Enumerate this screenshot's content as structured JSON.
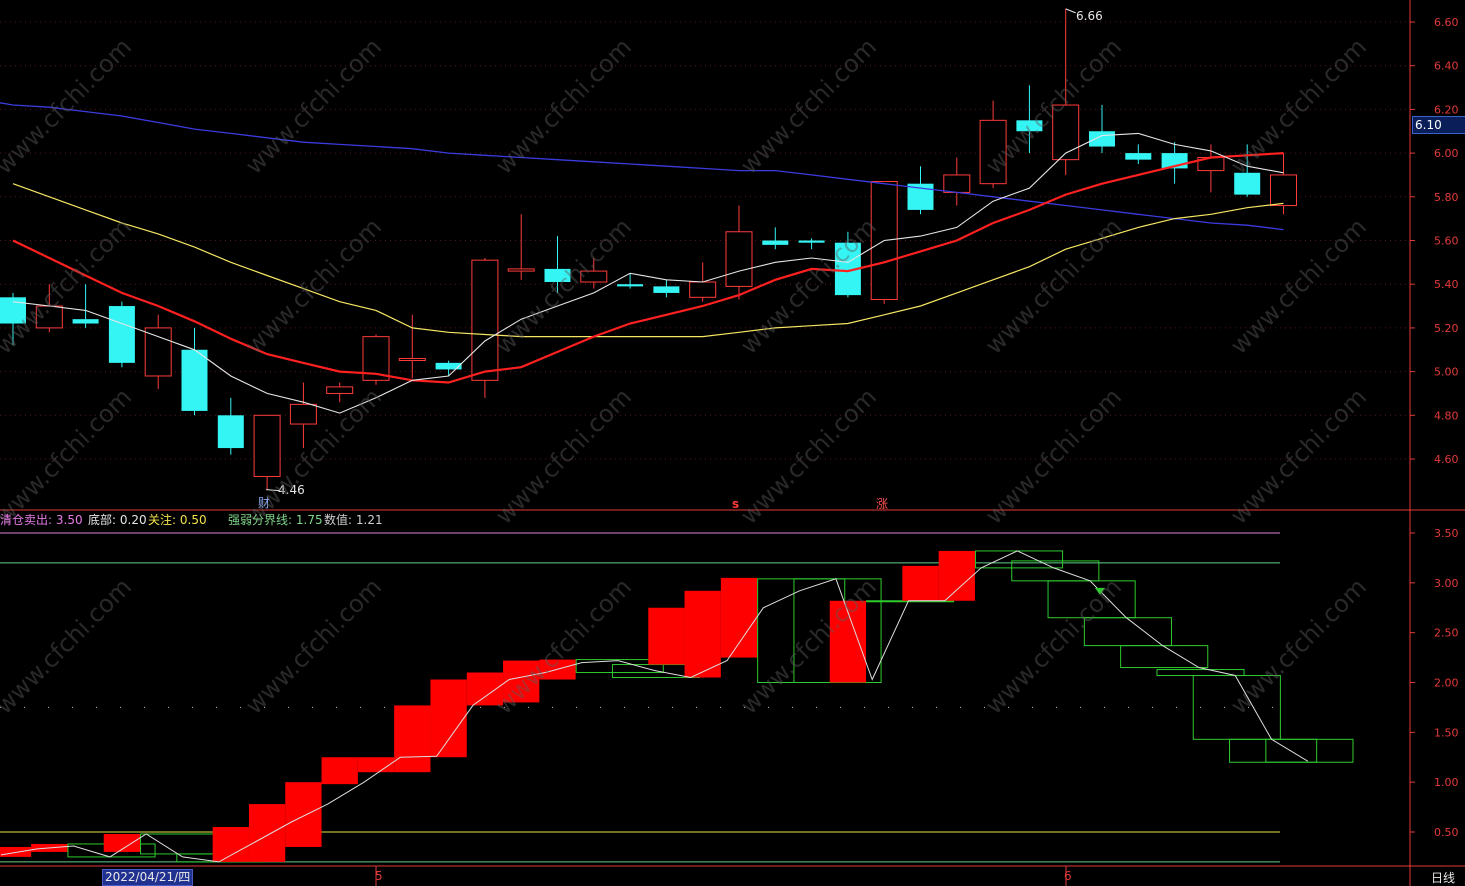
{
  "colors": {
    "background": "#000000",
    "up": "#ff3b3b",
    "down": "#34f4f4",
    "ma_white": "#e6e6e6",
    "ma_red": "#ff2020",
    "ma_yellow": "#f5e663",
    "ma_blue": "#3b3be0",
    "axis": "#e23a3a",
    "box_green": "#2ecc2e",
    "box_red": "#ff0000"
  },
  "markers": {
    "high_label": "6.66",
    "low_label": "4.46",
    "event_cai": "财",
    "event_s": "s",
    "event_zhang": "涨"
  },
  "last_price": "6.10",
  "indicator": {
    "items": [
      {
        "key": "清仓卖出",
        "sep": ": ",
        "value": "3.50",
        "color": "#e77be7"
      },
      {
        "key": "底部",
        "sep": ": ",
        "value": "0.20",
        "color": "#e6e6e6"
      },
      {
        "key": "关注",
        "sep": ": ",
        "value": "0.50",
        "color": "#f3e34a"
      },
      {
        "key": "强弱分界线",
        "sep": ": ",
        "value": "1.75",
        "color": "#7fd68a"
      },
      {
        "key": "数值",
        "sep": ": ",
        "value": "1.21",
        "color": "#cfcfcf"
      }
    ]
  },
  "bottom_axis": {
    "date_label": "2022/04/21/四",
    "month_5": "5",
    "month_6": "6",
    "tab_label": "日线"
  },
  "watermark_text": "www.cfchi.com",
  "chart_data": [
    {
      "type": "candlestick",
      "title": "",
      "ylim": [
        4.4,
        6.7
      ],
      "yticks": [
        "6.60",
        "6.40",
        "6.20",
        "6.00",
        "5.80",
        "5.60",
        "5.40",
        "5.20",
        "5.00",
        "4.80",
        "4.60"
      ],
      "grid": true,
      "candles": [
        {
          "o": 5.34,
          "h": 5.36,
          "l": 5.12,
          "c": 5.22
        },
        {
          "o": 5.2,
          "h": 5.4,
          "l": 5.18,
          "c": 5.3
        },
        {
          "o": 5.24,
          "h": 5.4,
          "l": 5.2,
          "c": 5.22
        },
        {
          "o": 5.3,
          "h": 5.32,
          "l": 5.02,
          "c": 5.04
        },
        {
          "o": 4.98,
          "h": 5.26,
          "l": 4.92,
          "c": 5.2
        },
        {
          "o": 5.1,
          "h": 5.2,
          "l": 4.8,
          "c": 4.82
        },
        {
          "o": 4.8,
          "h": 4.88,
          "l": 4.62,
          "c": 4.65
        },
        {
          "o": 4.52,
          "h": 4.8,
          "l": 4.46,
          "c": 4.8
        },
        {
          "o": 4.76,
          "h": 4.95,
          "l": 4.65,
          "c": 4.85
        },
        {
          "o": 4.9,
          "h": 4.95,
          "l": 4.86,
          "c": 4.93
        },
        {
          "o": 4.96,
          "h": 5.17,
          "l": 4.94,
          "c": 5.16
        },
        {
          "o": 5.06,
          "h": 5.26,
          "l": 4.97,
          "c": 5.06
        },
        {
          "o": 5.04,
          "h": 5.05,
          "l": 4.98,
          "c": 5.01
        },
        {
          "o": 4.96,
          "h": 5.52,
          "l": 4.88,
          "c": 5.51
        },
        {
          "o": 5.46,
          "h": 5.72,
          "l": 5.42,
          "c": 5.47
        },
        {
          "o": 5.47,
          "h": 5.62,
          "l": 5.36,
          "c": 5.41
        },
        {
          "o": 5.41,
          "h": 5.52,
          "l": 5.38,
          "c": 5.46
        },
        {
          "o": 5.4,
          "h": 5.45,
          "l": 5.38,
          "c": 5.39
        },
        {
          "o": 5.39,
          "h": 5.42,
          "l": 5.34,
          "c": 5.36
        },
        {
          "o": 5.34,
          "h": 5.5,
          "l": 5.32,
          "c": 5.41
        },
        {
          "o": 5.39,
          "h": 5.76,
          "l": 5.33,
          "c": 5.64
        },
        {
          "o": 5.6,
          "h": 5.66,
          "l": 5.56,
          "c": 5.58
        },
        {
          "o": 5.6,
          "h": 5.61,
          "l": 5.56,
          "c": 5.59
        },
        {
          "o": 5.59,
          "h": 5.64,
          "l": 5.34,
          "c": 5.35
        },
        {
          "o": 5.33,
          "h": 5.87,
          "l": 5.31,
          "c": 5.87
        },
        {
          "o": 5.86,
          "h": 5.94,
          "l": 5.72,
          "c": 5.74
        },
        {
          "o": 5.82,
          "h": 5.98,
          "l": 5.76,
          "c": 5.9
        },
        {
          "o": 5.86,
          "h": 6.24,
          "l": 5.84,
          "c": 6.15
        },
        {
          "o": 6.15,
          "h": 6.31,
          "l": 6.0,
          "c": 6.1
        },
        {
          "o": 5.97,
          "h": 6.66,
          "l": 5.9,
          "c": 6.22
        },
        {
          "o": 6.1,
          "h": 6.22,
          "l": 6.0,
          "c": 6.03
        },
        {
          "o": 6.0,
          "h": 6.04,
          "l": 5.95,
          "c": 5.97
        },
        {
          "o": 6.0,
          "h": 6.05,
          "l": 5.86,
          "c": 5.93
        },
        {
          "o": 5.92,
          "h": 6.04,
          "l": 5.82,
          "c": 5.98
        },
        {
          "o": 5.91,
          "h": 6.04,
          "l": 5.8,
          "c": 5.81
        },
        {
          "o": 5.76,
          "h": 6.0,
          "l": 5.72,
          "c": 5.9
        }
      ],
      "ma_white": [
        5.32,
        5.3,
        5.28,
        5.22,
        5.16,
        5.1,
        4.98,
        4.9,
        4.86,
        4.81,
        4.88,
        4.96,
        4.98,
        5.14,
        5.24,
        5.3,
        5.36,
        5.45,
        5.42,
        5.41,
        5.46,
        5.5,
        5.52,
        5.5,
        5.6,
        5.62,
        5.66,
        5.78,
        5.84,
        6.0,
        6.08,
        6.09,
        6.04,
        6.01,
        5.94,
        5.91
      ],
      "ma_red": [
        5.6,
        5.52,
        5.44,
        5.36,
        5.3,
        5.23,
        5.15,
        5.08,
        5.04,
        5.0,
        4.99,
        4.96,
        4.95,
        5.0,
        5.02,
        5.09,
        5.16,
        5.22,
        5.26,
        5.3,
        5.35,
        5.42,
        5.47,
        5.46,
        5.5,
        5.55,
        5.6,
        5.68,
        5.74,
        5.81,
        5.86,
        5.9,
        5.94,
        5.98,
        5.99,
        6.0
      ],
      "ma_yellow": [
        5.86,
        5.8,
        5.74,
        5.68,
        5.63,
        5.57,
        5.5,
        5.44,
        5.38,
        5.32,
        5.28,
        5.2,
        5.18,
        5.17,
        5.16,
        5.16,
        5.16,
        5.16,
        5.16,
        5.16,
        5.18,
        5.2,
        5.21,
        5.22,
        5.26,
        5.3,
        5.36,
        5.42,
        5.48,
        5.56,
        5.61,
        5.66,
        5.7,
        5.72,
        5.75,
        5.77
      ],
      "ma_blue": [
        6.22,
        6.21,
        6.19,
        6.17,
        6.14,
        6.11,
        6.09,
        6.07,
        6.05,
        6.04,
        6.03,
        6.02,
        6.0,
        5.99,
        5.98,
        5.97,
        5.96,
        5.95,
        5.94,
        5.93,
        5.92,
        5.92,
        5.9,
        5.88,
        5.86,
        5.84,
        5.82,
        5.8,
        5.78,
        5.76,
        5.74,
        5.72,
        5.7,
        5.68,
        5.67,
        5.65
      ]
    },
    {
      "type": "box-indicator",
      "title": "",
      "ylim": [
        0.0,
        3.6
      ],
      "yticks": [
        "3.50",
        "3.00",
        "2.50",
        "2.00",
        "1.50",
        "1.00",
        "0.50"
      ],
      "lines": {
        "清仓卖出": 3.5,
        "top_green": 3.2,
        "dotted": 1.75,
        "关注": 0.5,
        "底部": 0.2
      },
      "boxes": [
        {
          "lo": 0.25,
          "hi": 0.35,
          "color": "red"
        },
        {
          "lo": 0.3,
          "hi": 0.38,
          "color": "red"
        },
        {
          "lo": 0.25,
          "hi": 0.38,
          "color": "green"
        },
        {
          "lo": 0.3,
          "hi": 0.48,
          "color": "red"
        },
        {
          "lo": 0.28,
          "hi": 0.48,
          "color": "green"
        },
        {
          "lo": 0.2,
          "hi": 0.28,
          "color": "green"
        },
        {
          "lo": 0.2,
          "hi": 0.55,
          "color": "red"
        },
        {
          "lo": 0.2,
          "hi": 0.78,
          "color": "red"
        },
        {
          "lo": 0.35,
          "hi": 1.0,
          "color": "red"
        },
        {
          "lo": 0.98,
          "hi": 1.25,
          "color": "red"
        },
        {
          "lo": 1.1,
          "hi": 1.25,
          "color": "red"
        },
        {
          "lo": 1.1,
          "hi": 1.77,
          "color": "red"
        },
        {
          "lo": 1.25,
          "hi": 2.03,
          "color": "red"
        },
        {
          "lo": 1.77,
          "hi": 2.1,
          "color": "red"
        },
        {
          "lo": 1.8,
          "hi": 2.22,
          "color": "red"
        },
        {
          "lo": 2.03,
          "hi": 2.23,
          "color": "red"
        },
        {
          "lo": 2.1,
          "hi": 2.23,
          "color": "green"
        },
        {
          "lo": 2.05,
          "hi": 2.18,
          "color": "green"
        },
        {
          "lo": 2.18,
          "hi": 2.75,
          "color": "red"
        },
        {
          "lo": 2.05,
          "hi": 2.92,
          "color": "red"
        },
        {
          "lo": 2.25,
          "hi": 3.05,
          "color": "red"
        },
        {
          "lo": 2.0,
          "hi": 3.04,
          "color": "green"
        },
        {
          "lo": 2.0,
          "hi": 3.04,
          "color": "green"
        },
        {
          "lo": 2.0,
          "hi": 2.82,
          "color": "red"
        },
        {
          "lo": 2.82,
          "hi": 2.82,
          "color": "green"
        },
        {
          "lo": 2.82,
          "hi": 3.17,
          "color": "red"
        },
        {
          "lo": 2.82,
          "hi": 3.32,
          "color": "red"
        },
        {
          "lo": 3.15,
          "hi": 3.32,
          "color": "green"
        },
        {
          "lo": 3.02,
          "hi": 3.22,
          "color": "green"
        },
        {
          "lo": 2.65,
          "hi": 3.02,
          "color": "green"
        },
        {
          "lo": 2.37,
          "hi": 2.65,
          "color": "green"
        },
        {
          "lo": 2.15,
          "hi": 2.37,
          "color": "green"
        },
        {
          "lo": 2.07,
          "hi": 2.13,
          "color": "green"
        },
        {
          "lo": 1.43,
          "hi": 2.07,
          "color": "green"
        },
        {
          "lo": 1.2,
          "hi": 1.43,
          "color": "green"
        },
        {
          "lo": 1.2,
          "hi": 1.43,
          "color": "green"
        }
      ],
      "value_line": [
        0.27,
        0.33,
        0.36,
        0.25,
        0.48,
        0.25,
        0.2,
        0.4,
        0.6,
        0.78,
        1.0,
        1.25,
        1.26,
        1.77,
        2.03,
        2.1,
        2.2,
        2.22,
        2.12,
        2.05,
        2.22,
        2.75,
        2.92,
        3.04,
        2.03,
        2.82,
        2.82,
        3.15,
        3.32,
        3.15,
        3.02,
        2.65,
        2.37,
        2.15,
        2.07,
        1.43,
        1.21
      ]
    }
  ]
}
